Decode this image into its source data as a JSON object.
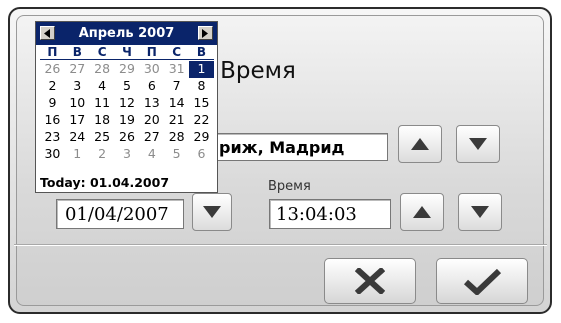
{
  "dialog": {
    "title": "Дата/Время",
    "title_visible_part": "аВремя",
    "timezone_value": "риж, Мадрид",
    "time_label": "Время",
    "date_value": "01/04/2007",
    "time_value": "13:04:03"
  },
  "buttons": {
    "tz_up": "arrow-up-icon",
    "tz_down": "arrow-down-icon",
    "date_dropdown": "arrow-down-icon",
    "time_up": "arrow-up-icon",
    "time_down": "arrow-down-icon",
    "cancel": "cross-icon",
    "ok": "checkmark-icon"
  },
  "calendar": {
    "month": "Апрель 2007",
    "weekdays": [
      "П",
      "В",
      "С",
      "Ч",
      "П",
      "С",
      "В"
    ],
    "weeks": [
      [
        {
          "d": "26",
          "o": true
        },
        {
          "d": "27",
          "o": true
        },
        {
          "d": "28",
          "o": true
        },
        {
          "d": "29",
          "o": true
        },
        {
          "d": "30",
          "o": true
        },
        {
          "d": "31",
          "o": true
        },
        {
          "d": "1",
          "s": true
        }
      ],
      [
        {
          "d": "2"
        },
        {
          "d": "3"
        },
        {
          "d": "4"
        },
        {
          "d": "5"
        },
        {
          "d": "6"
        },
        {
          "d": "7"
        },
        {
          "d": "8"
        }
      ],
      [
        {
          "d": "9"
        },
        {
          "d": "10"
        },
        {
          "d": "11"
        },
        {
          "d": "12"
        },
        {
          "d": "13"
        },
        {
          "d": "14"
        },
        {
          "d": "15"
        }
      ],
      [
        {
          "d": "16"
        },
        {
          "d": "17"
        },
        {
          "d": "18"
        },
        {
          "d": "19"
        },
        {
          "d": "20"
        },
        {
          "d": "21"
        },
        {
          "d": "22"
        }
      ],
      [
        {
          "d": "23"
        },
        {
          "d": "24"
        },
        {
          "d": "25"
        },
        {
          "d": "26"
        },
        {
          "d": "27"
        },
        {
          "d": "28"
        },
        {
          "d": "29"
        }
      ],
      [
        {
          "d": "30"
        },
        {
          "d": "1",
          "o": true
        },
        {
          "d": "2",
          "o": true
        },
        {
          "d": "3",
          "o": true
        },
        {
          "d": "4",
          "o": true
        },
        {
          "d": "5",
          "o": true
        },
        {
          "d": "6",
          "o": true
        }
      ]
    ],
    "today": "Today: 01.04.2007"
  },
  "colors": {
    "calendar_header": "#0a246a",
    "selected_day": "#0a246a",
    "frame": "#2b2b2b"
  }
}
